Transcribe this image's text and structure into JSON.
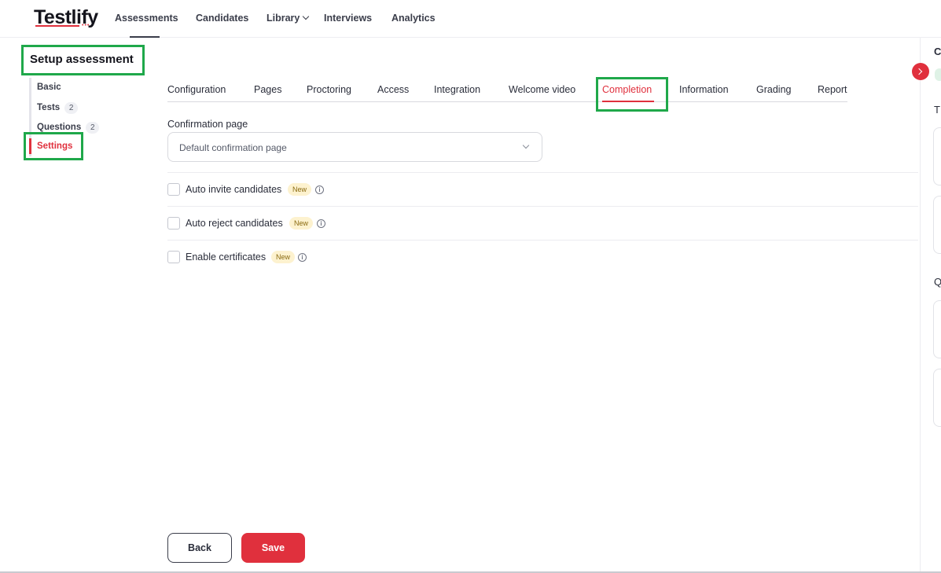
{
  "brand": {
    "logo_text": "Testlify"
  },
  "nav": {
    "assessments": "Assessments",
    "candidates": "Candidates",
    "library": "Library",
    "interviews": "Interviews",
    "analytics": "Analytics"
  },
  "sidebar": {
    "title": "Setup assessment",
    "items": [
      {
        "label": "Basic"
      },
      {
        "label": "Tests",
        "count": "2"
      },
      {
        "label": "Questions",
        "count": "2"
      },
      {
        "label": "Settings",
        "active": true
      }
    ]
  },
  "tabs": [
    {
      "label": "Configuration"
    },
    {
      "label": "Pages"
    },
    {
      "label": "Proctoring"
    },
    {
      "label": "Access"
    },
    {
      "label": "Integration"
    },
    {
      "label": "Welcome video"
    },
    {
      "label": "Completion",
      "active": true
    },
    {
      "label": "Information"
    },
    {
      "label": "Grading"
    },
    {
      "label": "Report"
    }
  ],
  "form": {
    "confirmation_label": "Confirmation page",
    "confirmation_value": "Default confirmation page",
    "options": [
      {
        "label": "Auto invite candidates",
        "badge": "New",
        "checked": false
      },
      {
        "label": "Auto reject candidates",
        "badge": "New",
        "checked": false
      },
      {
        "label": "Enable certificates",
        "badge": "New",
        "checked": false
      }
    ]
  },
  "actions": {
    "back": "Back",
    "save": "Save"
  },
  "right_panel": {
    "letters": [
      "C",
      "T",
      "Q"
    ]
  },
  "colors": {
    "accent": "#e0303d",
    "highlight": "#1fa84a",
    "badge_bg": "#fdf2cf"
  },
  "icons": [
    "chevron-down-icon",
    "info-icon",
    "chevron-right-icon"
  ]
}
